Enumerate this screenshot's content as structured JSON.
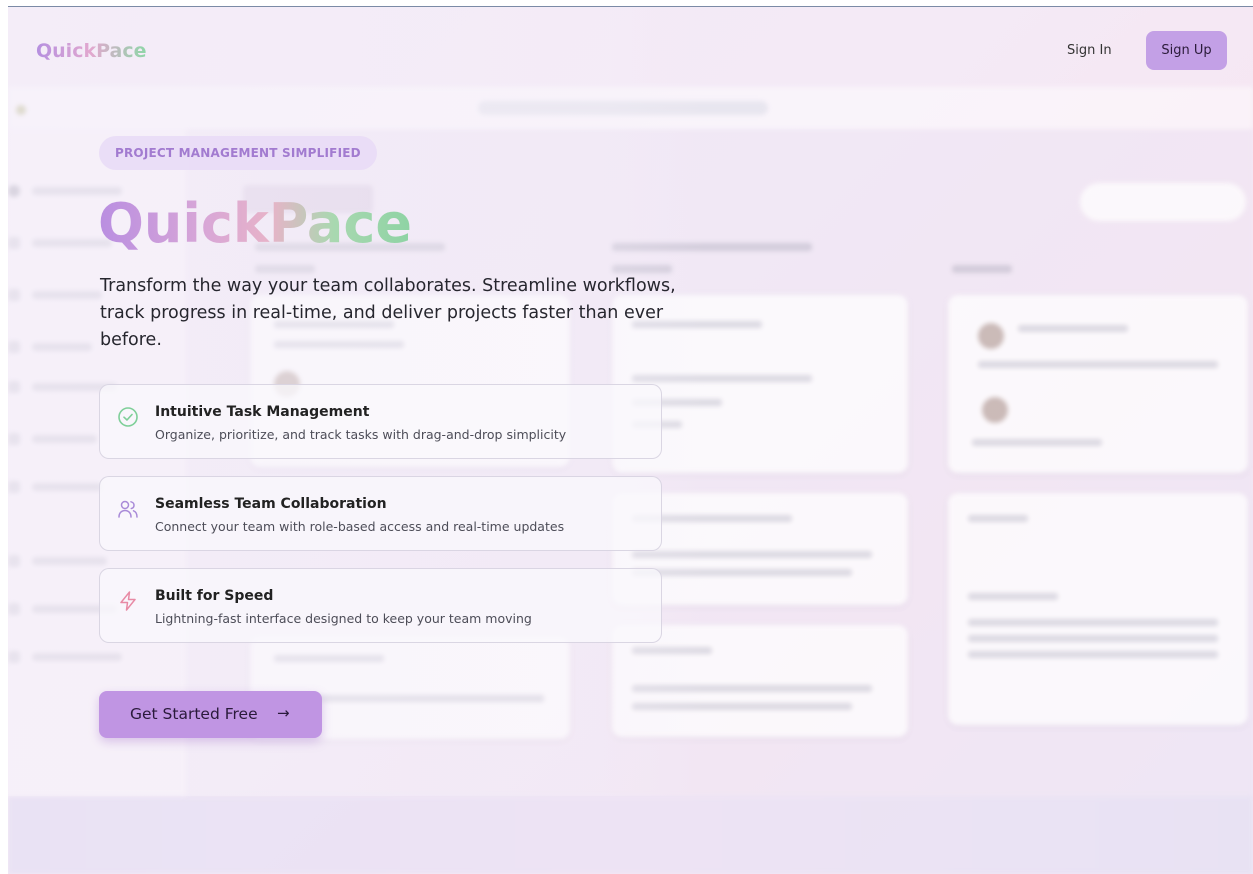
{
  "header": {
    "logo": "QuickPace",
    "sign_in": "Sign In",
    "sign_up": "Sign Up"
  },
  "hero": {
    "badge": "PROJECT MANAGEMENT SIMPLIFIED",
    "title": "QuickPace",
    "description": "Transform the way your team collaborates. Streamline workflows, track progress in real-time, and deliver projects faster than ever before."
  },
  "features": [
    {
      "icon": "check-circle-icon",
      "title": "Intuitive Task Management",
      "description": "Organize, prioritize, and track tasks with drag-and-drop simplicity"
    },
    {
      "icon": "users-icon",
      "title": "Seamless Team Collaboration",
      "description": "Connect your team with role-based access and real-time updates"
    },
    {
      "icon": "lightning-icon",
      "title": "Built for Speed",
      "description": "Lightning-fast interface designed to keep your team moving"
    }
  ],
  "cta": {
    "label": "Get Started Free",
    "arrow": "→"
  },
  "colors": {
    "accent": "#c095e3",
    "badge_text": "#a27bd0",
    "check_icon": "#7fcf99",
    "users_icon": "#a98ad8",
    "lightning_icon": "#e88aa5"
  }
}
